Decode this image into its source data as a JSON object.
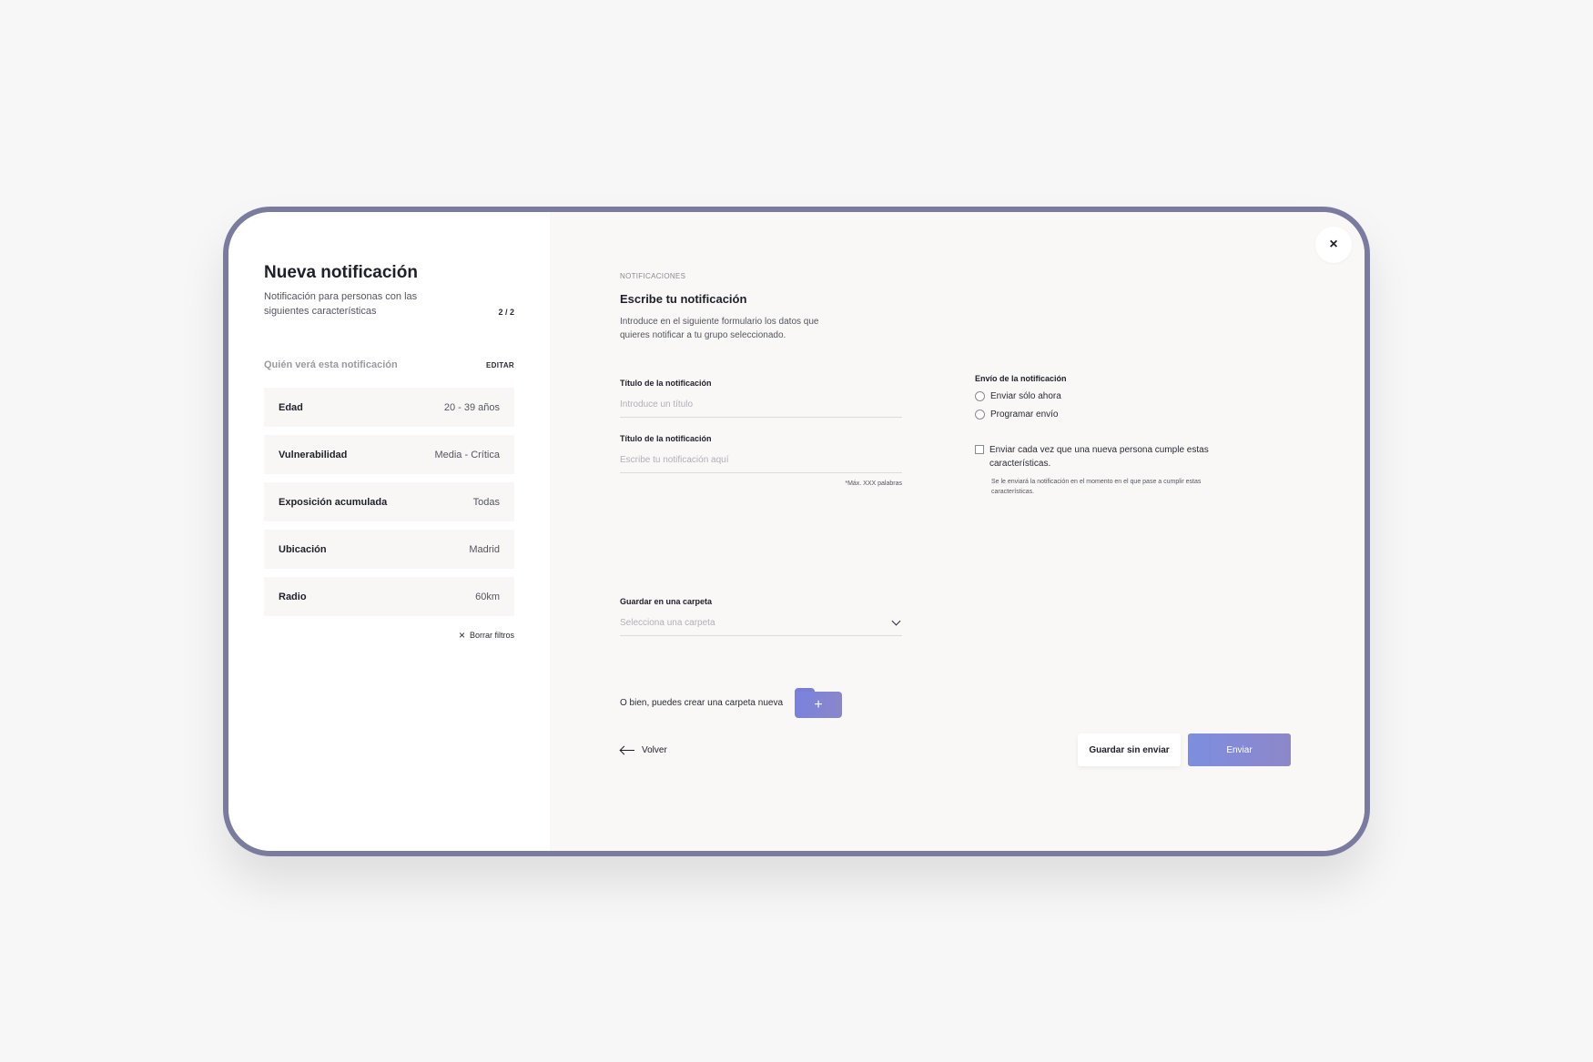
{
  "sidebar": {
    "title": "Nueva notificación",
    "subtitle": "Notificación para personas con las siguientes características",
    "step": "2 / 2",
    "who_label": "Quién verá esta notificación",
    "edit_label": "EDITAR",
    "filters": [
      {
        "label": "Edad",
        "value": "20 - 39 años"
      },
      {
        "label": "Vulnerabilidad",
        "value": "Media - Crítica"
      },
      {
        "label": "Exposición acumulada",
        "value": "Todas"
      },
      {
        "label": "Ubicación",
        "value": "Madrid"
      },
      {
        "label": "Radio",
        "value": "60km"
      }
    ],
    "clear_label": "Borrar filtros",
    "clear_icon": "×"
  },
  "main": {
    "close_icon": "×",
    "section_label": "NOTIFICACIONES",
    "heading": "Escribe tu notificación",
    "description": "Introduce en el siguiente formulario los datos que quieres notificar a tu grupo seleccionado.",
    "title_field": {
      "label": "Título de la notificación",
      "placeholder": "Introduce un título",
      "value": ""
    },
    "body_field": {
      "label": "Título de la notificación",
      "placeholder": "Escribe tu notificación aquí",
      "value": "",
      "hint": "*Máx. XXX palabras"
    },
    "folder_field": {
      "label": "Guardar en una carpeta",
      "selected": "Selecciona una carpeta"
    },
    "create_folder_label": "O bien, puedes crear una carpeta nueva",
    "create_folder_icon": "+",
    "send_options": {
      "label": "Envío de la notificación",
      "radios": [
        "Enviar sólo ahora",
        "Programar envío"
      ],
      "checkbox_label": "Enviar cada vez que una nueva persona cumple estas características.",
      "checkbox_note": "Se le enviará la notificación en el momento en el que pase a cumplir estas características."
    },
    "back_label": "Volver",
    "save_label": "Guardar sin enviar",
    "send_label": "Enviar"
  },
  "colors": {
    "device_frame": "#7b7b9f",
    "accent": "#7d8ee0",
    "panel_bg": "#f9f8f6"
  }
}
